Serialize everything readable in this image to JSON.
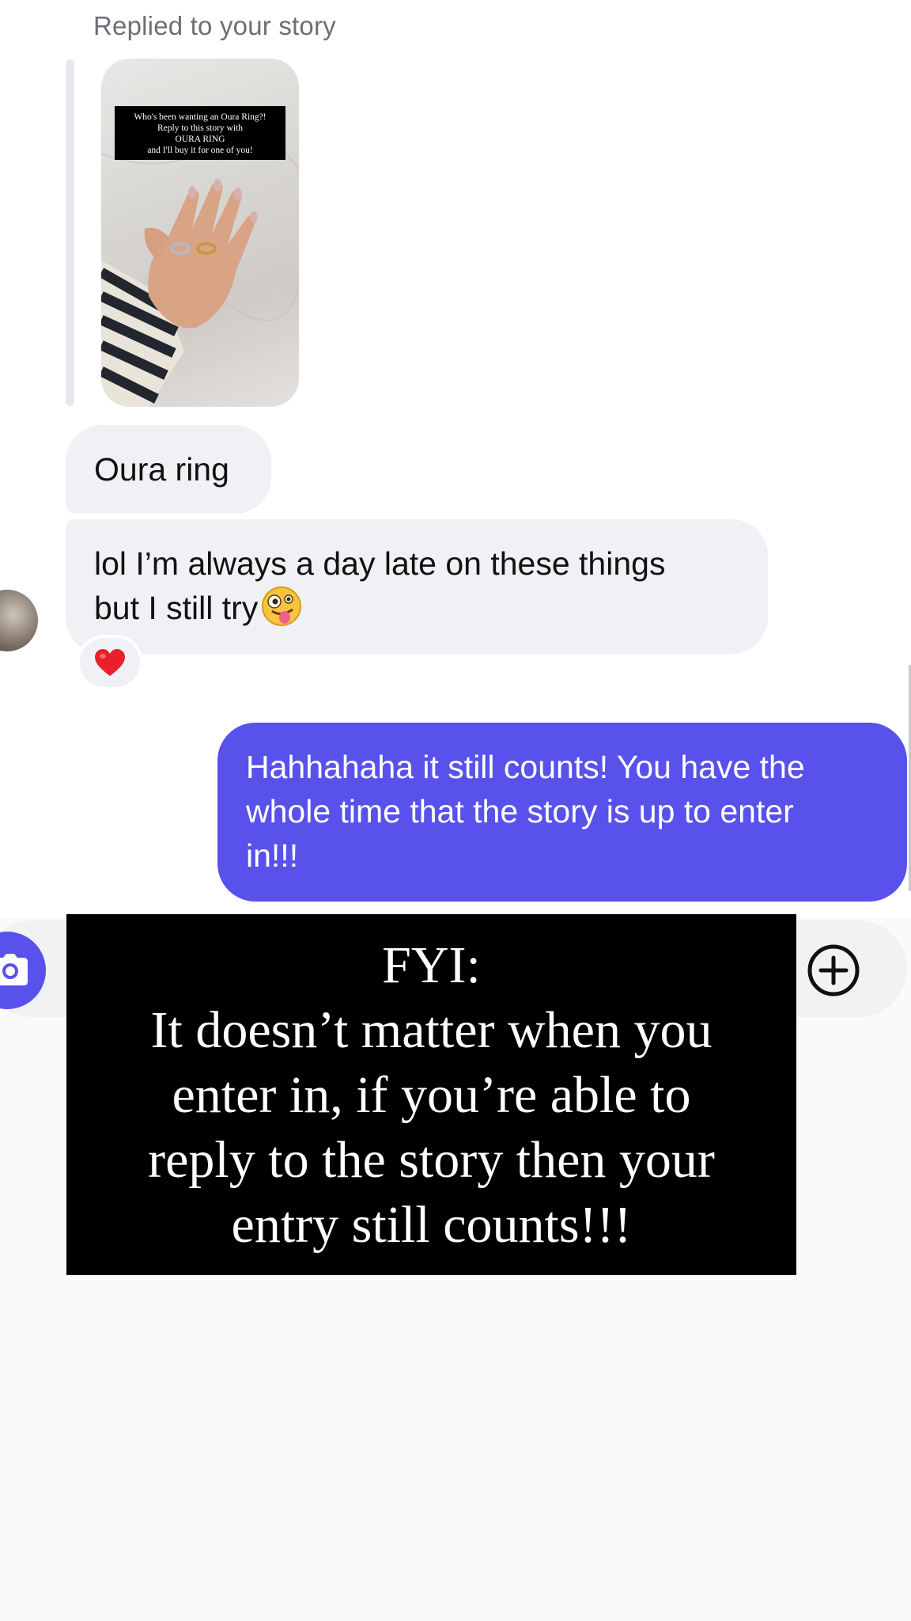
{
  "thread": {
    "story_reply": {
      "label": "Replied to your story",
      "story_caption_lines": [
        "Who's been wanting an Oura Ring?!",
        "Reply to this story with",
        "OURA RING",
        "and I'll buy it for one of you!"
      ]
    },
    "messages": {
      "incoming_1": "Oura ring",
      "incoming_2_line_1": "lol I’m always a day late on these things",
      "incoming_2_line_2": "but I still try",
      "incoming_2_emoji": "zany-face-emoji",
      "reaction": "heart",
      "outgoing_1_lines": [
        "Hahhahaha it still counts! You have the",
        "whole time that the story is up to enter",
        "in!!!"
      ]
    }
  },
  "composer": {
    "camera_icon": "camera-icon",
    "add_icon": "plus-circle-icon"
  },
  "overlay": {
    "lines": [
      "FYI:",
      "It doesn’t matter when you",
      "enter in, if you’re able to",
      "reply to the story then your",
      "entry still counts!!!"
    ]
  },
  "colors": {
    "outgoing_bubble": "#5851ec",
    "incoming_bubble": "#eff1f4",
    "reaction_heart": "#e8202a",
    "overlay_background": "#000000"
  }
}
